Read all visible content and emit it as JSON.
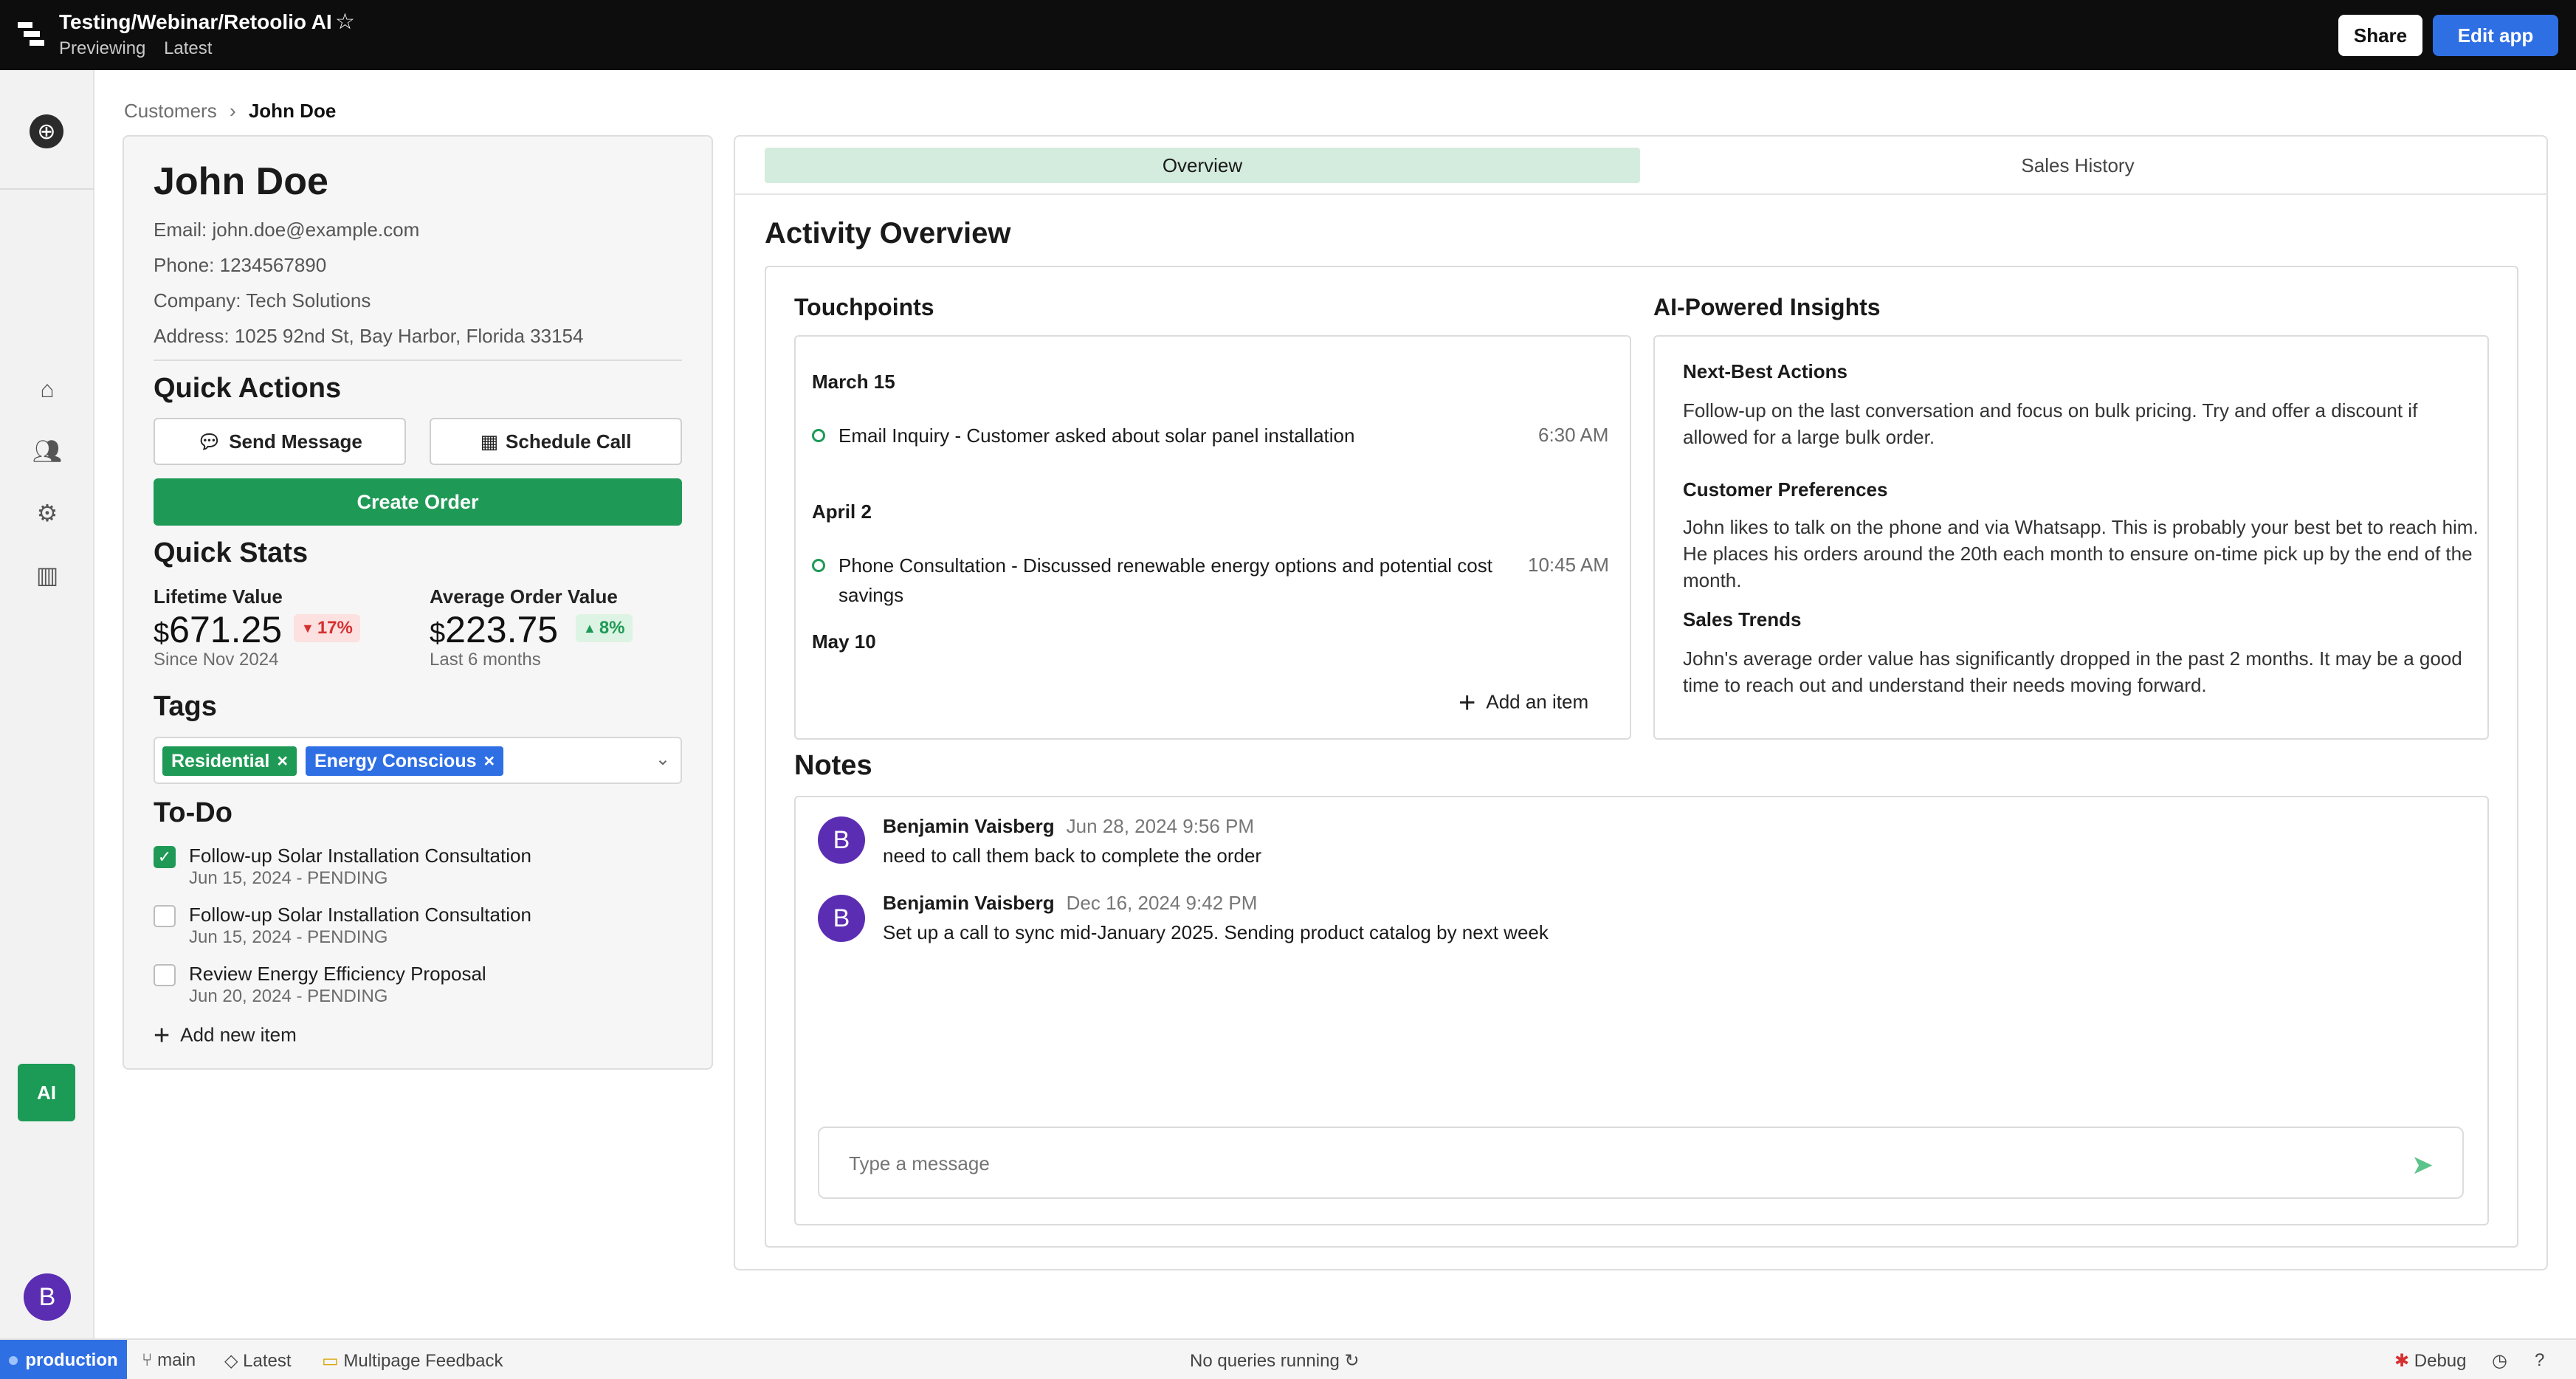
{
  "app": {
    "title": "Testing/Webinar/Retoolio AI",
    "previewing": "Previewing",
    "version": "Latest",
    "share_label": "Share",
    "edit_label": "Edit app"
  },
  "breadcrumb": {
    "parent": "Customers",
    "separator": "›",
    "current": "John Doe"
  },
  "customer": {
    "name": "John Doe",
    "email": "Email: john.doe@example.com",
    "phone": "Phone: 1234567890",
    "company": "Company: Tech Solutions",
    "address": "Address: 1025 92nd St, Bay Harbor, Florida 33154"
  },
  "quick_actions": {
    "heading": "Quick Actions",
    "send_message": "Send Message",
    "schedule_call": "Schedule Call",
    "create_order": "Create Order"
  },
  "quick_stats": {
    "heading": "Quick Stats",
    "lifetime_label": "Lifetime Value",
    "lifetime_currency": "$",
    "lifetime_value": "671.25",
    "lifetime_change": "17%",
    "lifetime_sub": "Since Nov 2024",
    "aov_label": "Average Order Value",
    "aov_currency": "$",
    "aov_value": "223.75",
    "aov_change": "8%",
    "aov_sub": "Last 6 months"
  },
  "tags": {
    "heading": "Tags",
    "items": [
      {
        "label": "Residential",
        "color": "#1f9a56"
      },
      {
        "label": "Energy Conscious",
        "color": "#2f6fe4"
      }
    ]
  },
  "todo": {
    "heading": "To-Do",
    "items": [
      {
        "title": "Follow-up Solar Installation Consultation",
        "date": "Jun 15, 2024 - PENDING",
        "checked": true
      },
      {
        "title": "Follow-up Solar Installation Consultation",
        "date": "Jun 15, 2024 - PENDING",
        "checked": false
      },
      {
        "title": "Review Energy Efficiency Proposal",
        "date": "Jun 20, 2024 - PENDING",
        "checked": false
      }
    ],
    "add_label": "Add new item"
  },
  "tabs": {
    "overview": "Overview",
    "sales_history": "Sales History"
  },
  "activity": {
    "heading": "Activity Overview",
    "touchpoints_heading": "Touchpoints",
    "touchpoints": [
      {
        "date": "March 15",
        "text": "Email Inquiry - Customer asked about solar panel installation",
        "time": "6:30 AM"
      },
      {
        "date": "April 2",
        "text": "Phone Consultation - Discussed renewable energy options and potential cost savings",
        "time": "10:45 AM"
      },
      {
        "date": "May 10"
      }
    ],
    "add_item_label": "Add an item",
    "insights_heading": "AI-Powered Insights",
    "insights": [
      {
        "title": "Next-Best Actions",
        "text": "Follow-up on the last conversation and focus on bulk pricing. Try and offer a discount if allowed for a large bulk order."
      },
      {
        "title": "Customer Preferences",
        "text": "John likes to talk on the phone and via Whatsapp. This is probably your best bet to reach him. He places his orders around the 20th each month to ensure on-time pick up by the end of the month."
      },
      {
        "title": "Sales Trends",
        "text": "John's average order value has significantly dropped in the past 2 months. It may be a good time to reach out and understand their needs moving forward."
      }
    ]
  },
  "notes": {
    "heading": "Notes",
    "items": [
      {
        "initial": "B",
        "author": "Benjamin Vaisberg",
        "date": "Jun 28, 2024 9:56 PM",
        "text": "need to call them back to complete the order"
      },
      {
        "initial": "B",
        "author": "Benjamin Vaisberg",
        "date": "Dec 16, 2024 9:42 PM",
        "text": "Set up a call to sync mid-January 2025. Sending product catalog by next week"
      }
    ],
    "placeholder": "Type a message"
  },
  "sidebar": {
    "ai_label": "AI",
    "avatar_initial": "B"
  },
  "footer": {
    "env": "production",
    "branch": "main",
    "version": "Latest",
    "feedback": "Multipage Feedback",
    "queries": "No queries running",
    "debug": "Debug"
  },
  "colors": {
    "accent": "#2f6fe4",
    "success": "#1f9a56",
    "danger": "#d53030",
    "avatar": "#5b2db3"
  },
  "icons": [
    "retool-logo-icon",
    "star-icon",
    "globe-icon",
    "home-icon",
    "users-icon",
    "gear-icon",
    "chart-icon",
    "chat-icon",
    "calendar-icon",
    "plus-icon",
    "send-icon",
    "branch-icon",
    "tag-icon",
    "refresh-icon",
    "history-icon",
    "help-icon"
  ]
}
